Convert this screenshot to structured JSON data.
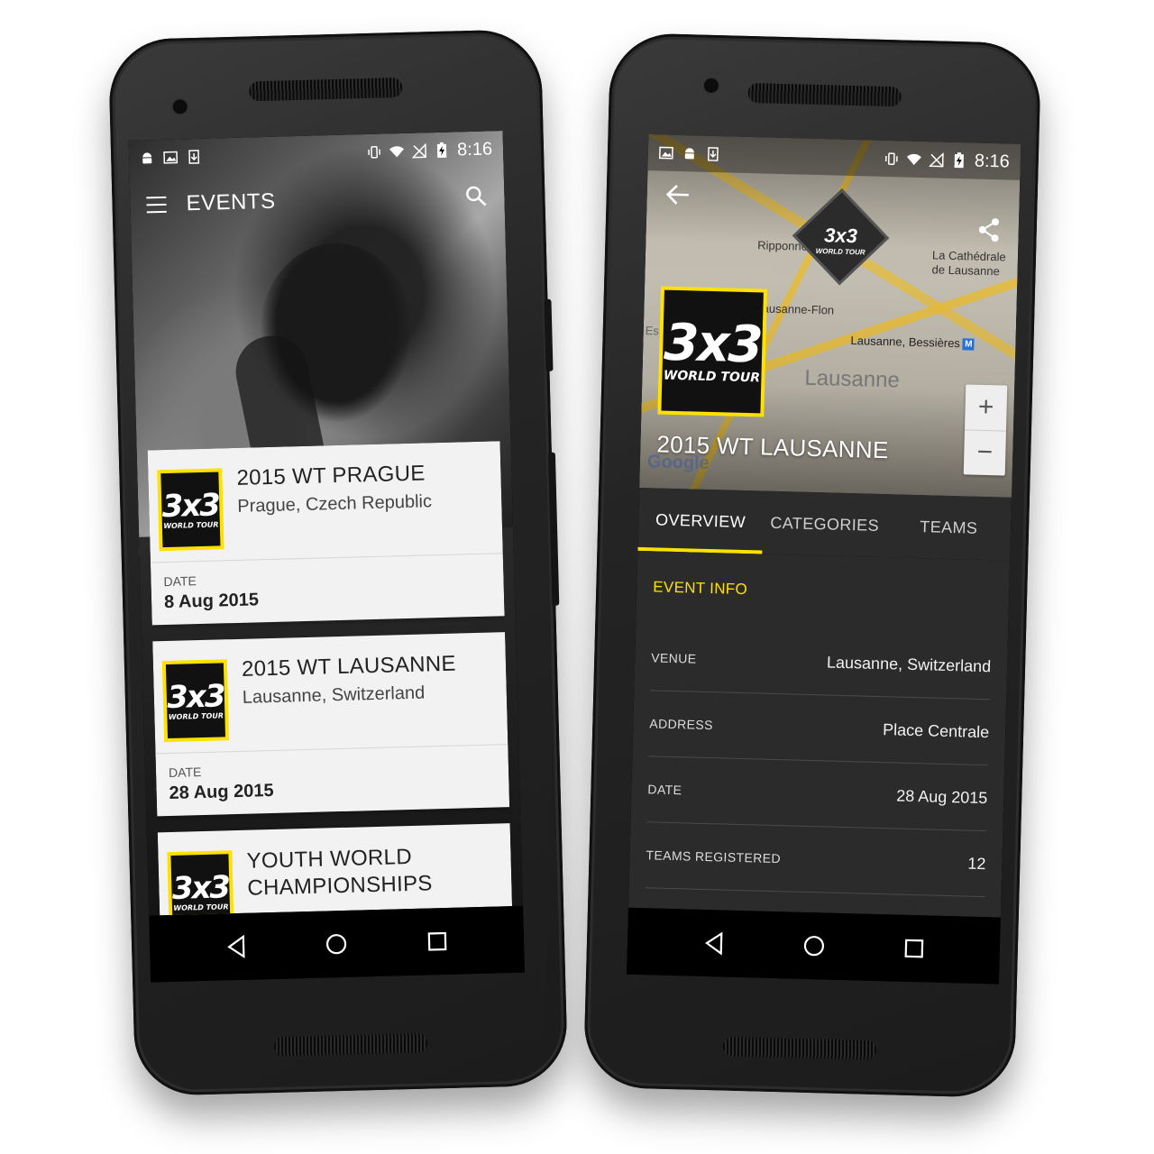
{
  "left_screen": {
    "status": {
      "time": "8:16"
    },
    "appbar": {
      "title": "EVENTS"
    },
    "events": [
      {
        "name": "2015 WT PRAGUE",
        "location": "Prague, Czech Republic",
        "date_label": "DATE",
        "date": "8 Aug 2015"
      },
      {
        "name": "2015 WT LAUSANNE",
        "location": "Lausanne, Switzerland",
        "date_label": "DATE",
        "date": "28 Aug 2015"
      },
      {
        "name": "YOUTH WORLD CHAMPIONSHIPS",
        "location": "",
        "date_label": "",
        "date": ""
      }
    ]
  },
  "right_screen": {
    "status": {
      "time": "8:16"
    },
    "map": {
      "labels": [
        "Ripponne",
        "La Cathédrale de Lausanne",
        "Lausanne, Bessières",
        "Lausanne",
        "Lausanne-Flon",
        "Esp"
      ],
      "zoom_in": "+",
      "zoom_out": "−",
      "attribution": "Google"
    },
    "event_title": "2015 WT LAUSANNE",
    "tabs": [
      "OVERVIEW",
      "CATEGORIES",
      "TEAMS"
    ],
    "active_tab": "OVERVIEW",
    "section_title": "EVENT INFO",
    "info": [
      {
        "label": "VENUE",
        "value": "Lausanne, Switzerland"
      },
      {
        "label": "ADDRESS",
        "value": "Place Centrale"
      },
      {
        "label": "DATE",
        "value": "28 Aug 2015"
      },
      {
        "label": "TEAMS REGISTERED",
        "value": "12"
      }
    ]
  },
  "brand": {
    "logo_text": "3x3",
    "logo_subtext": "WORLD TOUR",
    "accent_color": "#ffe100",
    "dark_color": "#2b2b2b"
  },
  "icons": {
    "statusbar_left": [
      "android-icon",
      "image-icon",
      "download-icon"
    ],
    "statusbar_right": [
      "vibrate-icon",
      "wifi-icon",
      "no-signal-icon",
      "battery-charging-icon"
    ],
    "navbar": [
      "back-nav-icon",
      "home-nav-icon",
      "recents-nav-icon"
    ]
  }
}
